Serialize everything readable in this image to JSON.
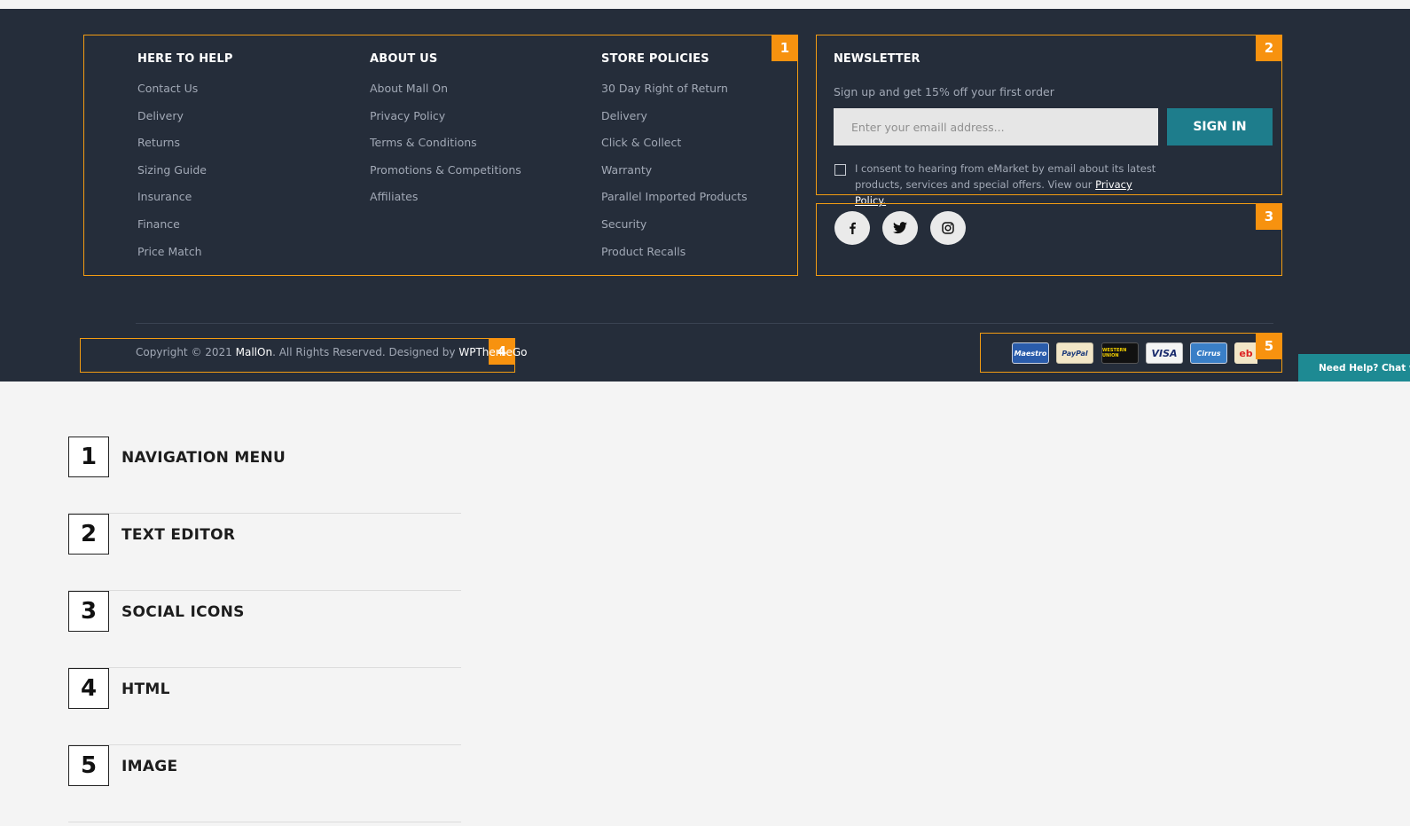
{
  "footer": {
    "columns": [
      {
        "title": "HERE TO HELP",
        "links": [
          "Contact Us",
          "Delivery",
          "Returns",
          "Sizing Guide",
          "Insurance",
          "Finance",
          "Price Match"
        ]
      },
      {
        "title": "ABOUT US",
        "links": [
          "About Mall On",
          "Privacy Policy",
          "Terms & Conditions",
          "Promotions & Competitions",
          "Affiliates"
        ]
      },
      {
        "title": "STORE POLICIES",
        "links": [
          "30 Day Right of Return",
          "Delivery",
          "Click & Collect",
          "Warranty",
          "Parallel Imported Products",
          "Security",
          "Product Recalls"
        ]
      }
    ],
    "newsletter": {
      "title": "NEWSLETTER",
      "subtitle": "Sign up and get 15% off your first order",
      "placeholder": "Enter your emaill address...",
      "button": "SIGN IN",
      "consent": "I consent to hearing from eMarket by email about its latest products, services and special offers. View our",
      "consent_link": "Privacy Policy."
    },
    "social": [
      "facebook-icon",
      "twitter-icon",
      "instagram-icon"
    ],
    "copyright": {
      "prefix": "Copyright © 2021",
      "brand": "MallOn",
      "middle": ". All Rights Reserved. Designed by",
      "designer": "WPThemeGo"
    },
    "payments": [
      "Maestro",
      "PayPal",
      "WESTERN UNION",
      "VISA",
      "Cirrus",
      "eb"
    ],
    "chat": "Need Help? Chat w"
  },
  "markers": [
    "1",
    "2",
    "3",
    "4",
    "5"
  ],
  "legend": [
    {
      "num": "1",
      "label": "NAVIGATION MENU"
    },
    {
      "num": "2",
      "label": "TEXT EDITOR"
    },
    {
      "num": "3",
      "label": "SOCIAL ICONS"
    },
    {
      "num": "4",
      "label": "HTML"
    },
    {
      "num": "5",
      "label": "IMAGE"
    }
  ],
  "colors": {
    "footer_bg": "#252d3a",
    "accent_orange": "#f7920f",
    "button_teal": "#1e7d8c",
    "page_bg": "#f4f4f4"
  }
}
